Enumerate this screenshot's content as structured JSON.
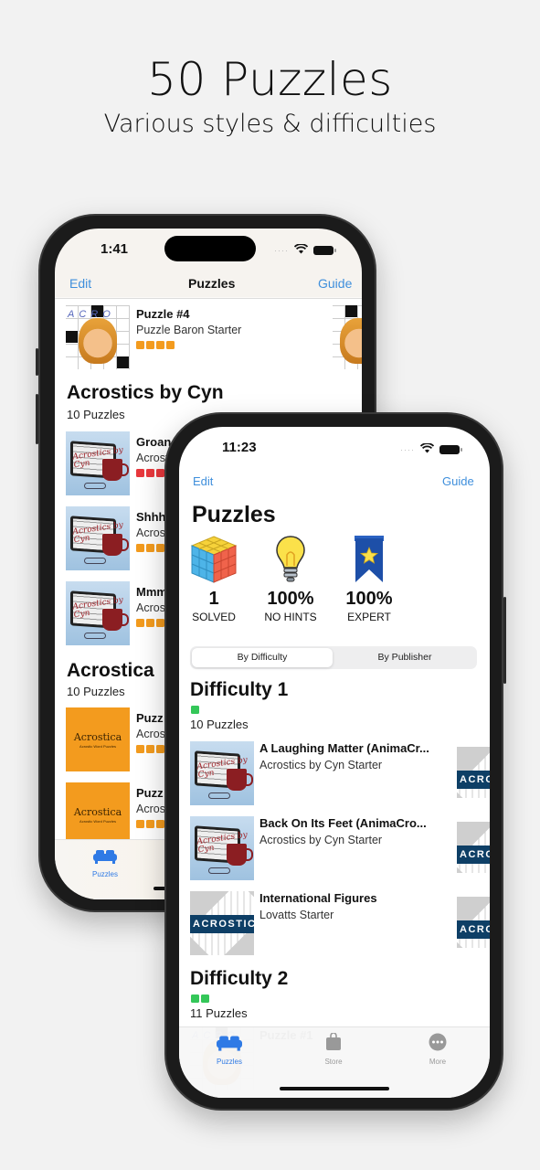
{
  "promo": {
    "headline": "50 Puzzles",
    "subline": "Various styles & difficulties"
  },
  "back_phone": {
    "status": {
      "time": "1:41"
    },
    "nav": {
      "left": "Edit",
      "title": "Puzzles",
      "right": "Guide"
    },
    "top_row": {
      "title": "Puzzle #4",
      "subtitle": "Puzzle Baron Starter",
      "difficulty": 4,
      "difficulty_color": "#f39b1e"
    },
    "sections": [
      {
        "title": "Acrostics by Cyn",
        "count": "10 Puzzles",
        "rows": [
          {
            "title": "Groan",
            "subtitle": "Acrost",
            "difficulty_color": "#e8383d"
          },
          {
            "title": "Shhh",
            "subtitle": "Acros",
            "difficulty_color": "#f39b1e"
          },
          {
            "title": "Mmm",
            "subtitle": "Acros",
            "difficulty_color": "#f39b1e"
          }
        ]
      },
      {
        "title": "Acrostica",
        "count": "10 Puzzles",
        "rows": [
          {
            "title": "Puzz",
            "subtitle": "Acros",
            "difficulty_color": "#f39b1e",
            "thumb_brand": "Acrostica",
            "thumb_tag": "Acrostic Word Puzzles"
          },
          {
            "title": "Puzz",
            "subtitle": "Acros",
            "difficulty_color": "#f39b1e",
            "thumb_brand": "Acrostica",
            "thumb_tag": "Acrostic Word Puzzles"
          }
        ]
      }
    ],
    "tabbar": {
      "puzzles": "Puzzles"
    }
  },
  "front_phone": {
    "status": {
      "time": "11:23"
    },
    "nav": {
      "left": "Edit",
      "right": "Guide"
    },
    "large_title": "Puzzles",
    "stats": [
      {
        "icon": "rubiks-cube-icon",
        "value": "1",
        "label": "SOLVED"
      },
      {
        "icon": "lightbulb-icon",
        "value": "100%",
        "label": "NO HINTS"
      },
      {
        "icon": "ribbon-star-icon",
        "value": "100%",
        "label": "EXPERT"
      }
    ],
    "segments": {
      "selected": "By Difficulty",
      "other": "By Publisher"
    },
    "sections": [
      {
        "title": "Difficulty 1",
        "difficulty": 1,
        "count": "10 Puzzles",
        "rows": [
          {
            "title": "A Laughing Matter (AnimaCr...",
            "subtitle": "Acrostics by Cyn Starter",
            "thumb": "Acrostics by Cyn"
          },
          {
            "title": "Back On Its Feet (AnimaCro...",
            "subtitle": "Acrostics by Cyn Starter",
            "thumb": "Acrostics by Cyn"
          },
          {
            "title": "International Figures",
            "subtitle": "Lovatts Starter",
            "thumb": "ACROSTIC"
          }
        ]
      },
      {
        "title": "Difficulty 2",
        "difficulty": 2,
        "count": "11 Puzzles",
        "rows": [
          {
            "title": "Puzzle #1",
            "subtitle": "",
            "thumb": "Puzzle Baron"
          }
        ]
      }
    ],
    "difficulty_color": "#34c759",
    "tabbar": {
      "puzzles": "Puzzles",
      "store": "Store",
      "more": "More"
    },
    "accent": "#2f7ae5"
  },
  "thumb_text": {
    "cyn_label": "Acrostics by Cyn",
    "lovatts_band": "ACROSTIC",
    "lovatts_band_cut": "ACRO",
    "baron_letters": "ACRO"
  }
}
